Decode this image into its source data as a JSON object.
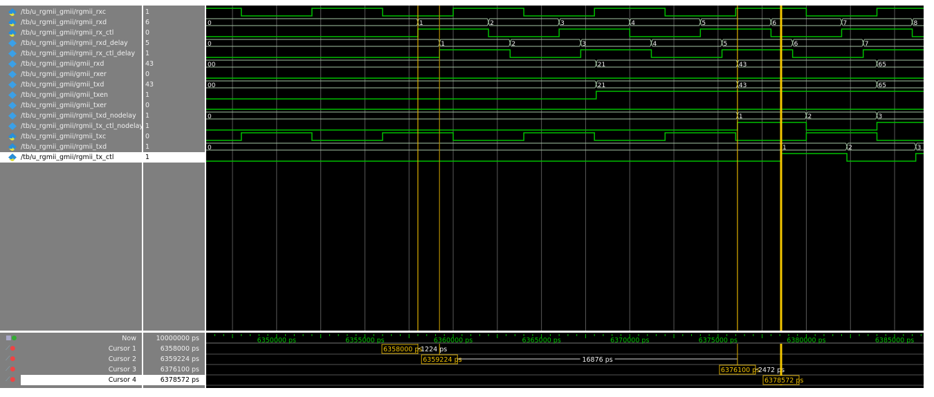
{
  "time_unit": "ps",
  "active_cursor_index": 3,
  "colors": {
    "scalar": "#00c000",
    "bus": "#a8c8a8",
    "grid": "#5a5a5a",
    "cursor": "#e0b000",
    "cursor_active": "#f5c800",
    "ruler": "#00c000",
    "background": "#000000",
    "panel": "#7f7f7f"
  },
  "signals": [
    {
      "name": "/tb/u_rgmii_gmii/rgmii_rxc",
      "value": "1",
      "type": "scalar",
      "icon": "input-port-icon",
      "initial": "1",
      "events": [
        [
          6348000,
          "0"
        ],
        [
          6352000,
          "1"
        ],
        [
          6356000,
          "0"
        ],
        [
          6360000,
          "1"
        ],
        [
          6364000,
          "0"
        ],
        [
          6368000,
          "1"
        ],
        [
          6372000,
          "0"
        ],
        [
          6376000,
          "1"
        ],
        [
          6380000,
          "0"
        ],
        [
          6384000,
          "1"
        ]
      ]
    },
    {
      "name": "/tb/u_rgmii_gmii/rgmii_rxd",
      "value": "6",
      "type": "bus",
      "icon": "input-port-icon",
      "initial": "0",
      "events": [
        [
          6358000,
          "1"
        ],
        [
          6362000,
          "2"
        ],
        [
          6366000,
          "3"
        ],
        [
          6370000,
          "4"
        ],
        [
          6374000,
          "5"
        ],
        [
          6378000,
          "6"
        ],
        [
          6382000,
          "7"
        ],
        [
          6386000,
          "8"
        ]
      ]
    },
    {
      "name": "/tb/u_rgmii_gmii/rgmii_rx_ctl",
      "value": "0",
      "type": "scalar",
      "icon": "input-port-icon",
      "initial": "0",
      "events": [
        [
          6358000,
          "1"
        ],
        [
          6362000,
          "0"
        ],
        [
          6366000,
          "1"
        ],
        [
          6370000,
          "0"
        ],
        [
          6374000,
          "1"
        ],
        [
          6378000,
          "0"
        ],
        [
          6382000,
          "1"
        ],
        [
          6386000,
          "0"
        ]
      ]
    },
    {
      "name": "/tb/u_rgmii_gmii/rgmii_rxd_delay",
      "value": "5",
      "type": "bus",
      "icon": "signal-icon",
      "initial": "0",
      "events": [
        [
          6359224,
          "1"
        ],
        [
          6363224,
          "2"
        ],
        [
          6367224,
          "3"
        ],
        [
          6371224,
          "4"
        ],
        [
          6375224,
          "5"
        ],
        [
          6379224,
          "6"
        ],
        [
          6383224,
          "7"
        ]
      ]
    },
    {
      "name": "/tb/u_rgmii_gmii/rgmii_rx_ctl_delay",
      "value": "1",
      "type": "scalar",
      "icon": "signal-icon",
      "initial": "0",
      "events": [
        [
          6359224,
          "1"
        ],
        [
          6363224,
          "0"
        ],
        [
          6367224,
          "1"
        ],
        [
          6371224,
          "0"
        ],
        [
          6375224,
          "1"
        ],
        [
          6379224,
          "0"
        ],
        [
          6383224,
          "1"
        ]
      ]
    },
    {
      "name": "/tb/u_rgmii_gmii/gmii_rxd",
      "value": "43",
      "type": "bus",
      "icon": "signal-icon",
      "initial": "00",
      "events": [
        [
          6368100,
          "21"
        ],
        [
          6376100,
          "43"
        ],
        [
          6384000,
          "65"
        ]
      ]
    },
    {
      "name": "/tb/u_rgmii_gmii/gmii_rxer",
      "value": "0",
      "type": "scalar",
      "icon": "signal-icon",
      "initial": "0",
      "events": []
    },
    {
      "name": "/tb/u_rgmii_gmii/gmii_txd",
      "value": "43",
      "type": "bus",
      "icon": "signal-icon",
      "initial": "00",
      "events": [
        [
          6368100,
          "21"
        ],
        [
          6376100,
          "43"
        ],
        [
          6384000,
          "65"
        ]
      ]
    },
    {
      "name": "/tb/u_rgmii_gmii/gmii_txen",
      "value": "1",
      "type": "scalar",
      "icon": "signal-icon",
      "initial": "0",
      "events": [
        [
          6368100,
          "1"
        ]
      ]
    },
    {
      "name": "/tb/u_rgmii_gmii/gmii_txer",
      "value": "0",
      "type": "scalar",
      "icon": "signal-icon",
      "initial": "0",
      "events": []
    },
    {
      "name": "/tb/u_rgmii_gmii/rgmii_txd_nodelay",
      "value": "1",
      "type": "bus",
      "icon": "signal-icon",
      "initial": "0",
      "events": [
        [
          6376100,
          "1"
        ],
        [
          6380000,
          "2"
        ],
        [
          6384000,
          "3"
        ]
      ]
    },
    {
      "name": "/tb/u_rgmii_gmii/rgmii_tx_ctl_nodelay",
      "value": "1",
      "type": "scalar",
      "icon": "signal-icon",
      "initial": "0",
      "events": [
        [
          6376100,
          "1"
        ],
        [
          6380000,
          "0"
        ],
        [
          6384000,
          "1"
        ]
      ]
    },
    {
      "name": "/tb/u_rgmii_gmii/rgmii_txc",
      "value": "0",
      "type": "scalar",
      "icon": "output-port-icon",
      "initial": "0",
      "events": [
        [
          6348000,
          "1"
        ],
        [
          6352000,
          "0"
        ],
        [
          6356000,
          "1"
        ],
        [
          6360000,
          "0"
        ],
        [
          6364000,
          "1"
        ],
        [
          6368000,
          "0"
        ],
        [
          6372000,
          "1"
        ],
        [
          6376000,
          "0"
        ],
        [
          6380000,
          "1"
        ],
        [
          6384000,
          "0"
        ]
      ]
    },
    {
      "name": "/tb/u_rgmii_gmii/rgmii_txd",
      "value": "1",
      "type": "bus",
      "icon": "output-port-icon",
      "initial": "0",
      "events": [
        [
          6378572,
          "1"
        ],
        [
          6382300,
          "2"
        ],
        [
          6386200,
          "3"
        ]
      ]
    },
    {
      "name": "/tb/u_rgmii_gmii/rgmii_tx_ctl",
      "value": "1",
      "type": "scalar",
      "icon": "output-port-icon",
      "initial": "0",
      "events": [
        [
          6378572,
          "1"
        ],
        [
          6382300,
          "0"
        ],
        [
          6386200,
          "1"
        ]
      ],
      "selected": true
    }
  ],
  "now": {
    "label": "Now",
    "value": "10000000 ps"
  },
  "cursors": [
    {
      "label": "Cursor 1",
      "value": "6358000 ps",
      "time": 6358000,
      "delta": "1224 ps"
    },
    {
      "label": "Cursor 2",
      "value": "6359224 ps",
      "time": 6359224,
      "delta": "16876 ps"
    },
    {
      "label": "Cursor 3",
      "value": "6376100 ps",
      "time": 6376100,
      "delta": "2472 ps"
    },
    {
      "label": "Cursor 4",
      "value": "6378572 ps",
      "time": 6378572,
      "selected": true
    }
  ],
  "ruler": {
    "labels": [
      "6350000 ps",
      "6355000 ps",
      "6360000 ps",
      "6365000 ps",
      "6370000 ps",
      "6375000 ps",
      "6380000 ps",
      "6385000 ps"
    ],
    "label_times": [
      6350000,
      6355000,
      6360000,
      6365000,
      6370000,
      6375000,
      6380000,
      6385000
    ],
    "minor_step": 500,
    "major_step": 2500
  }
}
